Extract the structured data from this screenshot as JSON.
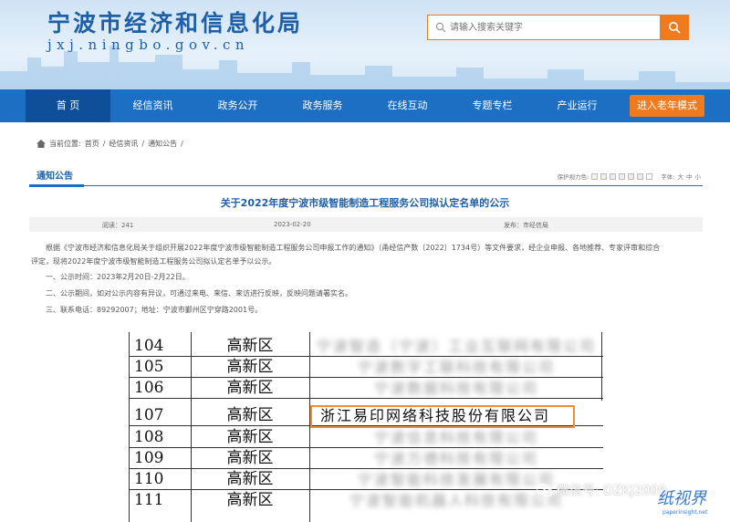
{
  "header": {
    "site_title": "宁波市经济和信息化局",
    "domain": "jxj.ningbo.gov.cn",
    "search_placeholder": "请输入搜索关键字"
  },
  "nav": {
    "items": [
      "首 页",
      "经信资讯",
      "政务公开",
      "政务服务",
      "在线互动",
      "专题专栏",
      "产业运行"
    ],
    "elder_mode": "进入老年模式"
  },
  "breadcrumb": {
    "label": "当前位置:",
    "items": [
      "首页",
      "经信资讯",
      "通知公告"
    ],
    "sep": "/"
  },
  "tab": {
    "label": "通知公告",
    "eye_label": "保护视力色:",
    "font_label": "字体:",
    "font_sizes": [
      "大",
      "中",
      "小"
    ],
    "colors": [
      "#f9f3e3",
      "#e8f3e3",
      "#e6eef8",
      "#eee",
      "#f6e9e9",
      "#ececec",
      "#fff"
    ]
  },
  "article": {
    "title": "关于2022年度宁波市级智能制造工程服务公司拟认定名单的公示",
    "reads": "阅读：241",
    "date": "2023-02-20",
    "publisher": "发布：市经信局",
    "para1": "根据《宁波市经济和信息化局关于组织开展2022年度宁波市级智能制造工程服务公司申报工作的通知》（甬经信产数〔2022〕1734号）等文件要求，经企业申报、各地推荐、专家评审和综合",
    "para1b": "评定，现将2022年度宁波市级智能制造工程服务公司拟认定名单予以公示。",
    "item1": "一、公示时间：2023年2月20日-2月22日。",
    "item2": "二、公示期间，如对公示内容有异议，可通过来电、来信、来访进行反映，反映问题请署实名。",
    "item3": "三、联系电话：89292007；地址：宁波市鄞州区宁穿路2001号。"
  },
  "table": {
    "rows": [
      {
        "num": "104",
        "district": "高新区",
        "company": "宁波智造（宁波）工业互联网有限公司"
      },
      {
        "num": "105",
        "district": "高新区",
        "company": "宁波数字工联科技有限公司"
      },
      {
        "num": "106",
        "district": "高新区",
        "company": "宁波数据科技有限公司"
      },
      {
        "num": "107",
        "district": "高新区",
        "company": "浙江易印网络科技股份有限公司"
      },
      {
        "num": "108",
        "district": "高新区",
        "company": "宁波信息科技有限公司"
      },
      {
        "num": "109",
        "district": "高新区",
        "company": "宁波万德科技有限公司"
      },
      {
        "num": "110",
        "district": "高新区",
        "company": "宁波智能科技发展有限公司"
      },
      {
        "num": "111",
        "district": "高新区",
        "company": "宁波智能机器人科技有限公司"
      }
    ]
  },
  "watermark": {
    "wechat": "微信号: DZKJ2009",
    "logo": "纸视界",
    "url": "paperinsight.net"
  }
}
